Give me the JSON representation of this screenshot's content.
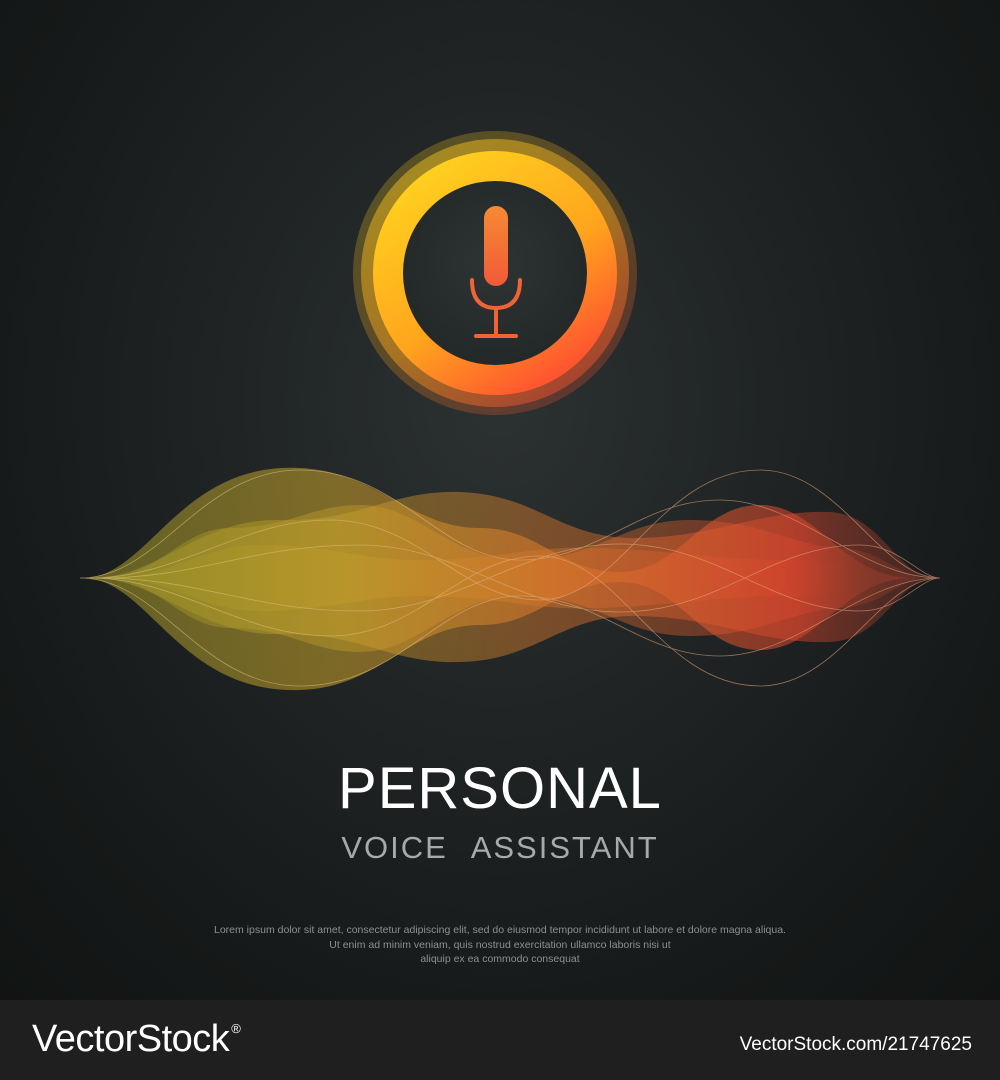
{
  "hero": {
    "icon": "microphone-icon",
    "ring_colors": [
      "#ffd21f",
      "#ffa51d",
      "#ff4b32"
    ],
    "mic_color": "#f26a36"
  },
  "waveform": {
    "colors": [
      "#c8a22a",
      "#e07a2c",
      "#e0472e"
    ]
  },
  "heading": {
    "title": "PERSONAL",
    "subtitle": "VOICE  ASSISTANT"
  },
  "description": {
    "lines": [
      "Lorem ipsum dolor sit amet, consectetur adipiscing elit, sed do eiusmod tempor incididunt ut labore et dolore magna aliqua.",
      "Ut enim ad minim veniam, quis nostrud exercitation ullamco laboris nisi ut",
      "aliquip ex ea commodo consequat"
    ]
  },
  "footer": {
    "brand": "VectorStock",
    "trademark": "®",
    "image_id": "VectorStock.com/21747625"
  }
}
